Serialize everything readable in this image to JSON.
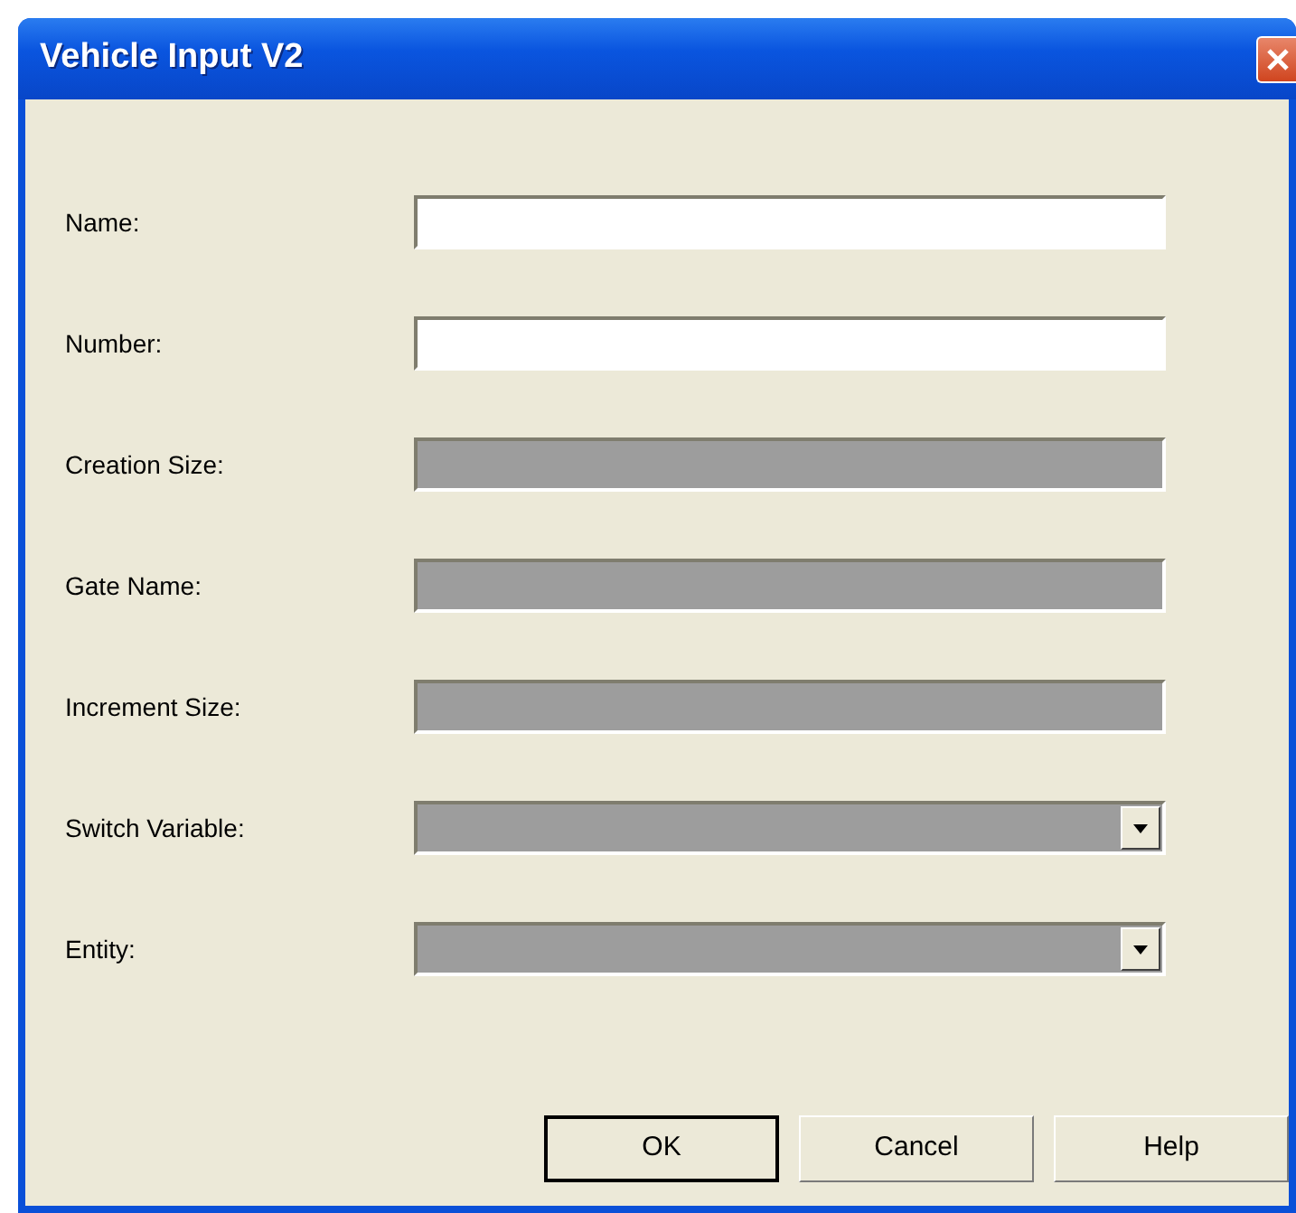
{
  "window": {
    "title": "Vehicle Input V2"
  },
  "fields": [
    {
      "label": "Name:",
      "kind": "text",
      "disabled": false
    },
    {
      "label": "Number:",
      "kind": "text",
      "disabled": false
    },
    {
      "label": "Creation Size:",
      "kind": "text",
      "disabled": true
    },
    {
      "label": "Gate Name:",
      "kind": "text",
      "disabled": true
    },
    {
      "label": "Increment Size:",
      "kind": "text",
      "disabled": true
    },
    {
      "label": "Switch Variable:",
      "kind": "combo",
      "disabled": true
    },
    {
      "label": "Entity:",
      "kind": "combo",
      "disabled": true
    }
  ],
  "buttons": [
    {
      "label": "OK",
      "default": true
    },
    {
      "label": "Cancel",
      "default": false
    },
    {
      "label": "Help",
      "default": false
    }
  ]
}
